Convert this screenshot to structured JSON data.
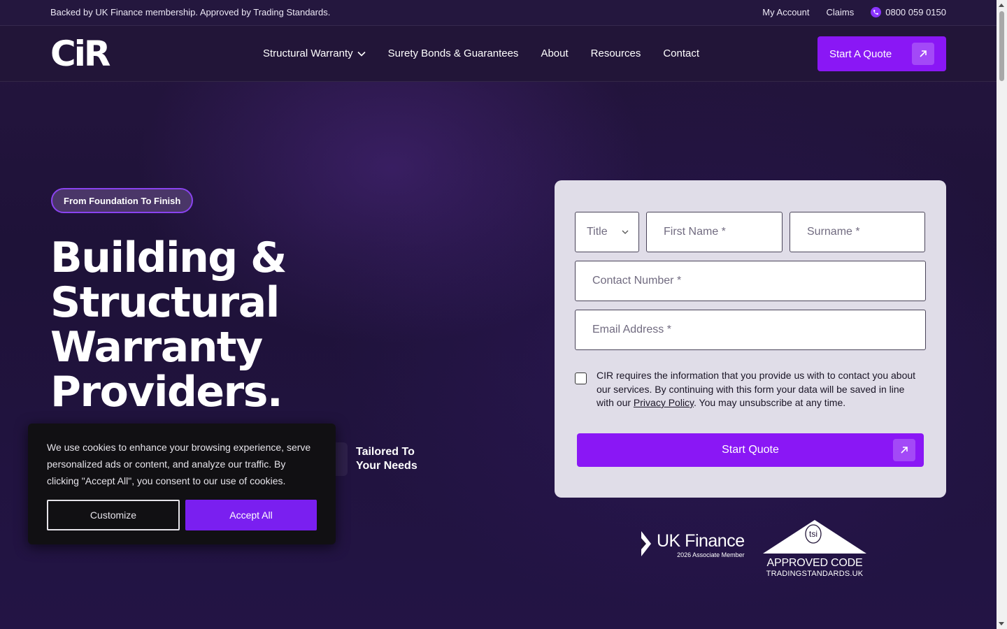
{
  "topbar": {
    "tagline": "Backed by UK Finance membership. Approved by Trading Standards.",
    "my_account": "My Account",
    "claims": "Claims",
    "phone": "0800 059 0150"
  },
  "nav": {
    "logo": "CiR",
    "items": [
      "Structural Warranty",
      "Surety Bonds & Guarantees",
      "About",
      "Resources",
      "Contact"
    ],
    "cta": "Start A Quote"
  },
  "hero": {
    "pill": "From Foundation To Finish",
    "headline_lines": [
      "Building &",
      "Structural",
      "Warranty",
      "Providers."
    ],
    "feature": "Tailored To Your Needs"
  },
  "form": {
    "title_placeholder": "Title",
    "first_name_placeholder": "First Name *",
    "surname_placeholder": "Surname *",
    "contact_placeholder": "Contact Number *",
    "email_placeholder": "Email Address *",
    "consent_before": "CIR requires the information that you provide us with to contact you about our services. By continuing with this form your data will be saved in line with our ",
    "consent_link": "Privacy Policy",
    "consent_after": ". You may unsubscribe at any time.",
    "submit": "Start Quote"
  },
  "badges": {
    "ukf_name": "UK Finance",
    "ukf_sub": "2026 Associate Member",
    "tsi_mark": "tsi",
    "tsi_code": "APPROVED CODE",
    "tsi_site": "TRADINGSTANDARDS.UK"
  },
  "cookie": {
    "message": "We use cookies to enhance your browsing experience, serve personalized ads or content, and analyze our traffic. By clicking \"Accept All\", you consent to our use of cookies.",
    "customize": "Customize",
    "accept": "Accept All"
  },
  "colors": {
    "accent": "#8a17f5",
    "background": "#1e1238",
    "card": "#e0dde8"
  }
}
